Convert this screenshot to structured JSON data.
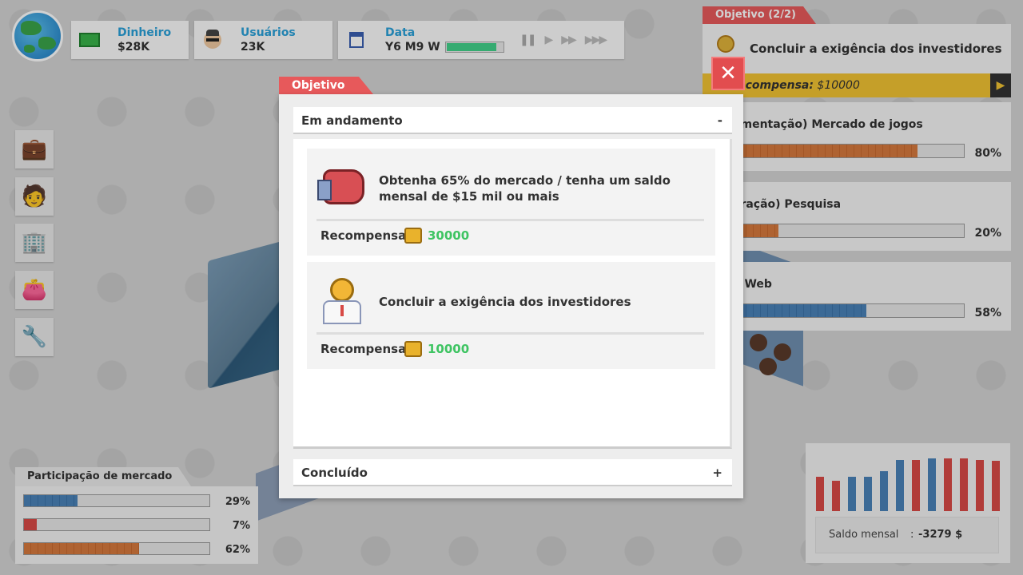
{
  "topbar": {
    "money_label": "Dinheiro",
    "money_value": "$28K",
    "users_label": "Usuários",
    "users_value": "23K",
    "date_label": "Data",
    "date_value": "Y6 M9 W",
    "date_progress_pct": 90,
    "icons": [
      "globe-icon",
      "cash-icon",
      "user-face-icon",
      "calendar-icon",
      "pause-icon",
      "play-icon",
      "fast-forward-icon",
      "fastest-forward-icon"
    ]
  },
  "left_menu": {
    "items": [
      "briefcase-icon",
      "employee-icon",
      "building-icon",
      "wallet-icon",
      "tools-icon"
    ]
  },
  "objective_panel": {
    "tab_label": "Objetivo (2/2)",
    "current_objective": "Concluir a exigência dos investidores",
    "reward_label": "Recompensa:",
    "reward_value": "$10000"
  },
  "research_cards": [
    {
      "title": "(Implementação) Mercado de jogos",
      "visible_title": "ementação) Mercado de jogos",
      "pct_label": "80%",
      "pct": 80,
      "color": "orange"
    },
    {
      "title": "(Preparação) Pesquisa",
      "visible_title": "aração) Pesquisa",
      "pct_label": "20%",
      "pct": 20,
      "color": "orange"
    },
    {
      "title": "Web",
      "visible_title": "o Web",
      "pct_label": "58%",
      "pct": 58,
      "color": "blue"
    }
  ],
  "market_share": {
    "title": "Participação de mercado",
    "rows": [
      {
        "pct_label": "29%",
        "pct": 29,
        "color": "#4a82b8"
      },
      {
        "pct_label": "7%",
        "pct": 7,
        "color": "#d84a46"
      },
      {
        "pct_label": "62%",
        "pct": 62,
        "color": "#d6793d"
      }
    ]
  },
  "monthly_balance": {
    "label": "Saldo mensal",
    "colon": ":",
    "value": "-3279 $",
    "bars": [
      {
        "color": "#d84a46",
        "h": 0.62
      },
      {
        "color": "#d84a46",
        "h": 0.55
      },
      {
        "color": "#4a82b8",
        "h": 0.62
      },
      {
        "color": "#4a82b8",
        "h": 0.62
      },
      {
        "color": "#4a82b8",
        "h": 0.72
      },
      {
        "color": "#4a82b8",
        "h": 0.92
      },
      {
        "color": "#d84a46",
        "h": 0.92
      },
      {
        "color": "#4a82b8",
        "h": 0.95
      },
      {
        "color": "#d84a46",
        "h": 0.95
      },
      {
        "color": "#d84a46",
        "h": 0.95
      },
      {
        "color": "#d84a46",
        "h": 0.92
      },
      {
        "color": "#d84a46",
        "h": 0.9
      }
    ]
  },
  "modal": {
    "tab_label": "Objetivo",
    "close_symbol": "✕",
    "in_progress_label": "Em andamento",
    "in_progress_toggle": "-",
    "completed_label": "Concluído",
    "completed_toggle": "+",
    "objectives": [
      {
        "icon": "boxing-glove-icon",
        "text": "Obtenha 65% do mercado / tenha um saldo mensal de $15 mil ou mais",
        "reward_label": "Recompensa:",
        "reward_value": "30000"
      },
      {
        "icon": "investor-icon",
        "text": "Concluir a exigência dos investidores",
        "reward_label": "Recompensa:",
        "reward_value": "10000"
      }
    ]
  },
  "colors": {
    "accent_red": "#e7595b",
    "money_green": "#3ec462",
    "label_blue": "#2aa0d8",
    "reward_yellow": "#f1c232"
  }
}
